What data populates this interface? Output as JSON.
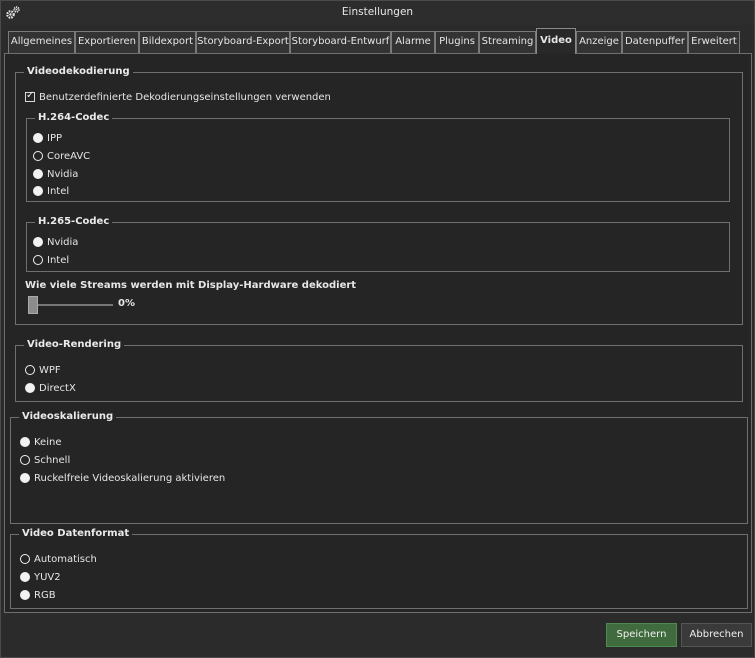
{
  "window": {
    "title": "Einstellungen"
  },
  "tabs": [
    {
      "label": "Allgemeines"
    },
    {
      "label": "Exportieren"
    },
    {
      "label": "Bildexport"
    },
    {
      "label": "Storyboard-Export"
    },
    {
      "label": "Storyboard-Entwurf"
    },
    {
      "label": "Alarme"
    },
    {
      "label": "Plugins"
    },
    {
      "label": "Streaming"
    },
    {
      "label": "Video",
      "active": true
    },
    {
      "label": "Anzeige"
    },
    {
      "label": "Datenpuffer"
    },
    {
      "label": "Erweitert"
    }
  ],
  "video_decoding": {
    "title": "Videodekodierung",
    "custom_checkbox": {
      "label": "Benutzerdefinierte Dekodierungseinstellungen verwenden",
      "checked": true
    },
    "h264": {
      "title": "H.264-Codec",
      "options": [
        {
          "label": "IPP",
          "selected": false
        },
        {
          "label": "CoreAVC",
          "selected": true
        },
        {
          "label": "Nvidia",
          "selected": false
        },
        {
          "label": "Intel",
          "selected": false
        }
      ]
    },
    "h265": {
      "title": "H.265-Codec",
      "options": [
        {
          "label": "Nvidia",
          "selected": false
        },
        {
          "label": "Intel",
          "selected": true
        }
      ]
    },
    "streams_label": "Wie viele Streams werden mit Display-Hardware dekodiert",
    "streams_value": "0%",
    "streams_fraction": 0
  },
  "video_rendering": {
    "title": "Video-Rendering",
    "options": [
      {
        "label": "WPF",
        "selected": true
      },
      {
        "label": "DirectX",
        "selected": false
      }
    ]
  },
  "video_scaling": {
    "title": "Videoskalierung",
    "options": [
      {
        "label": "Keine",
        "selected": false
      },
      {
        "label": "Schnell",
        "selected": true
      },
      {
        "label": "Ruckelfreie Videoskalierung aktivieren",
        "selected": false
      }
    ]
  },
  "video_format": {
    "title": "Video Datenformat",
    "options": [
      {
        "label": "Automatisch",
        "selected": true
      },
      {
        "label": "YUV2",
        "selected": false
      },
      {
        "label": "RGB",
        "selected": false
      }
    ]
  },
  "buttons": {
    "save": "Speichern",
    "cancel": "Abbrechen"
  },
  "colors": {
    "accent_button": "#3f6b3f",
    "background": "#2b2b2b"
  },
  "icons": {
    "title": "gear-icon"
  }
}
